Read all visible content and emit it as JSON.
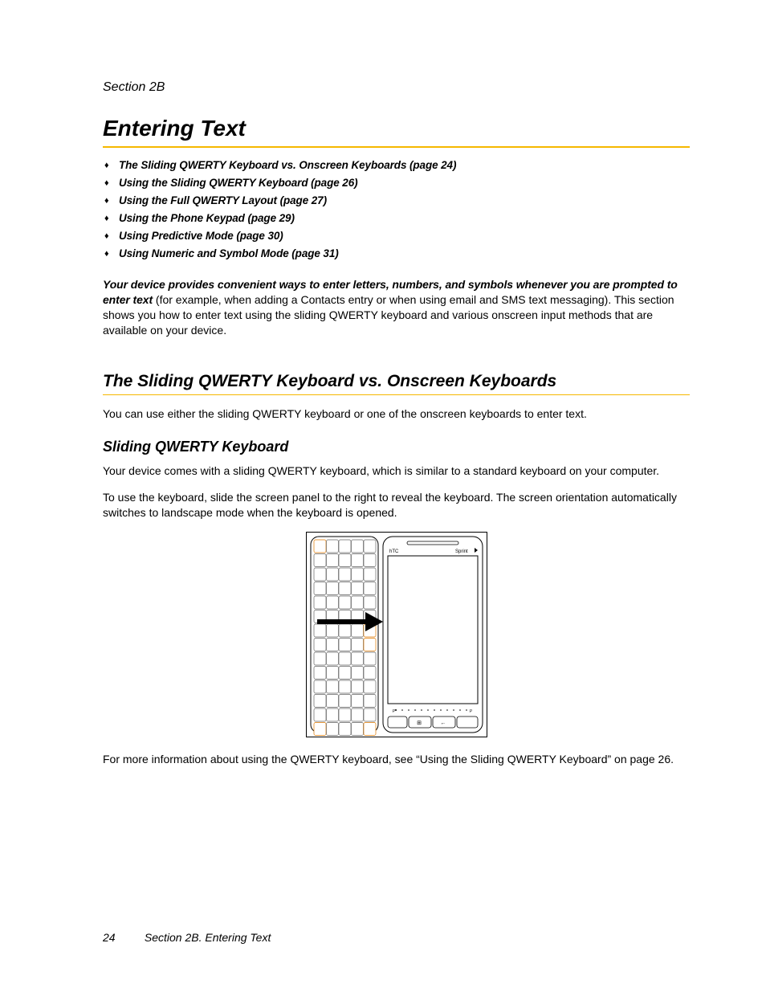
{
  "section_label": "Section 2B",
  "title": "Entering Text",
  "toc": [
    "The Sliding QWERTY Keyboard vs. Onscreen Keyboards (page 24)",
    "Using the Sliding QWERTY Keyboard (page 26)",
    "Using the Full QWERTY Layout (page 27)",
    "Using the Phone Keypad (page 29)",
    "Using Predictive Mode (page 30)",
    "Using Numeric and Symbol Mode (page 31)"
  ],
  "intro_lead": "Your device provides convenient ways to enter letters, numbers, and symbols whenever you are prompted to enter text",
  "intro_rest": " (for example, when adding a Contacts entry or when using email and SMS text messaging). This section shows you how to enter text using the sliding QWERTY keyboard and various onscreen input methods that are available on your device.",
  "h2_1": "The Sliding QWERTY Keyboard vs. Onscreen Keyboards",
  "p1": "You can use either the sliding QWERTY keyboard or one of the onscreen keyboards to enter text.",
  "h3_1": "Sliding QWERTY Keyboard",
  "p2": "Your device comes with a sliding QWERTY keyboard, which is similar to a standard keyboard on your computer.",
  "p3": "To use the keyboard, slide the screen panel to the right to reveal the keyboard. The screen orientation automatically switches to landscape mode when the keyboard is opened.",
  "p4": "For more information about using the QWERTY keyboard, see “Using the Sliding QWERTY Keyboard” on page 26.",
  "footer_page": "24",
  "footer_text": "Section 2B. Entering Text",
  "figure": {
    "brand": "hTC",
    "carrier": "Sprint"
  }
}
